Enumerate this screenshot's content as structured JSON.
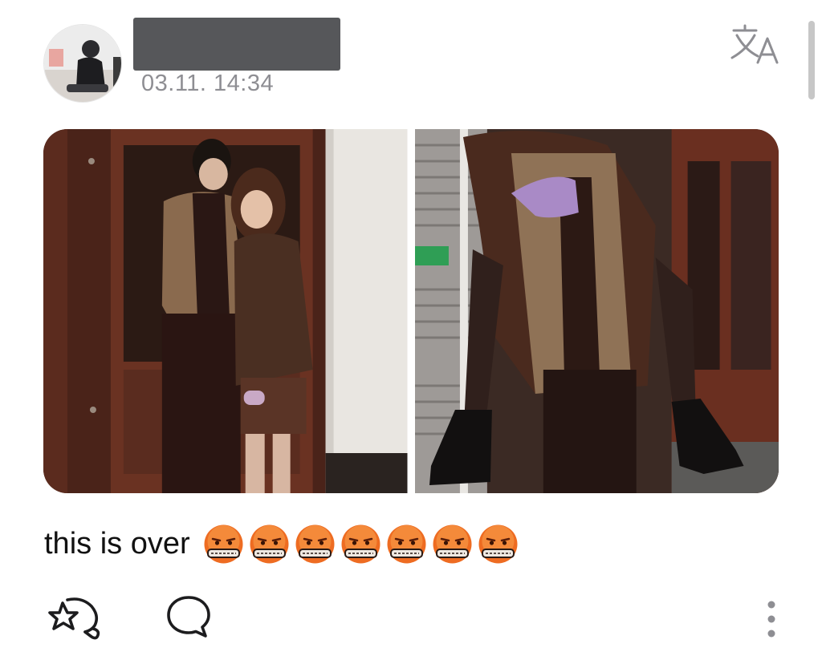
{
  "post": {
    "timestamp": "03.11. 14:34",
    "caption": "this is over",
    "emoji_count": 7
  },
  "icons": {
    "translate": "translate-icon",
    "like": "star-hand-icon",
    "comment": "speech-bubble-icon",
    "more": "more-vertical-icon",
    "reaction_emoji": "face-with-symbols-on-mouth-emoji"
  },
  "colors": {
    "timestamp": "#8e8e93",
    "redaction": "#56575a",
    "icon_stroke": "#1c1c1e",
    "emoji_face": "#ef6a1e"
  }
}
